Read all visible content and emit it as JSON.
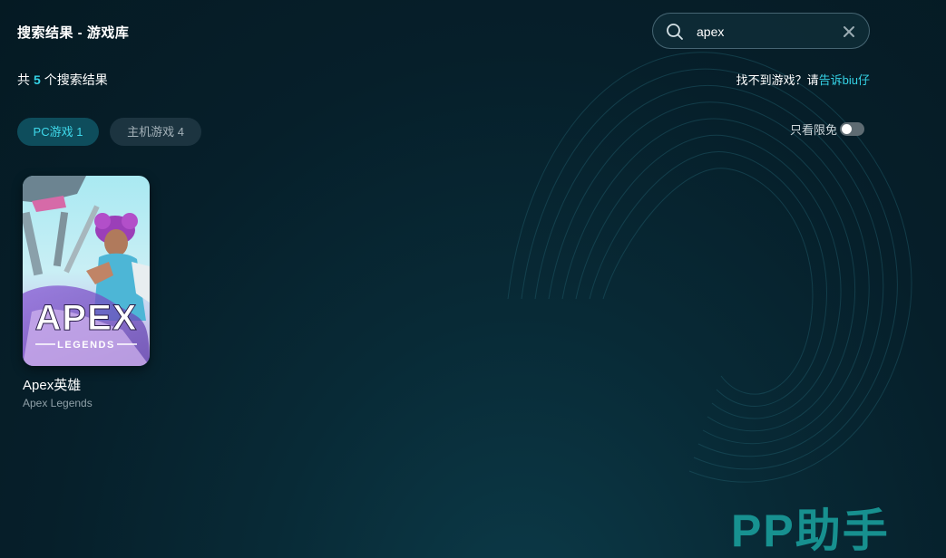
{
  "header": {
    "title": "搜索结果 - 游戏库"
  },
  "search": {
    "value": "apex",
    "icon": "search-icon",
    "clear_icon": "close-icon"
  },
  "results": {
    "prefix": "共",
    "count": "5",
    "suffix": "个搜索结果"
  },
  "feedback": {
    "text": "找不到游戏？请",
    "link": "告诉biu仔"
  },
  "tabs": [
    {
      "label": "PC游戏 1",
      "active": true
    },
    {
      "label": "主机游戏 4",
      "active": false
    }
  ],
  "filter": {
    "label": "只看限免",
    "enabled": false
  },
  "games": [
    {
      "name": "Apex英雄",
      "subtitle": "Apex Legends",
      "cover_text": "APEX",
      "cover_subtext": "LEGENDS"
    }
  ],
  "brand": {
    "text": "PP助手"
  },
  "colors": {
    "accent": "#35d3e6",
    "active_tab_bg": "#0e4d5c",
    "inactive_tab_bg": "#1c3440",
    "brand": "#1aa3a0"
  }
}
